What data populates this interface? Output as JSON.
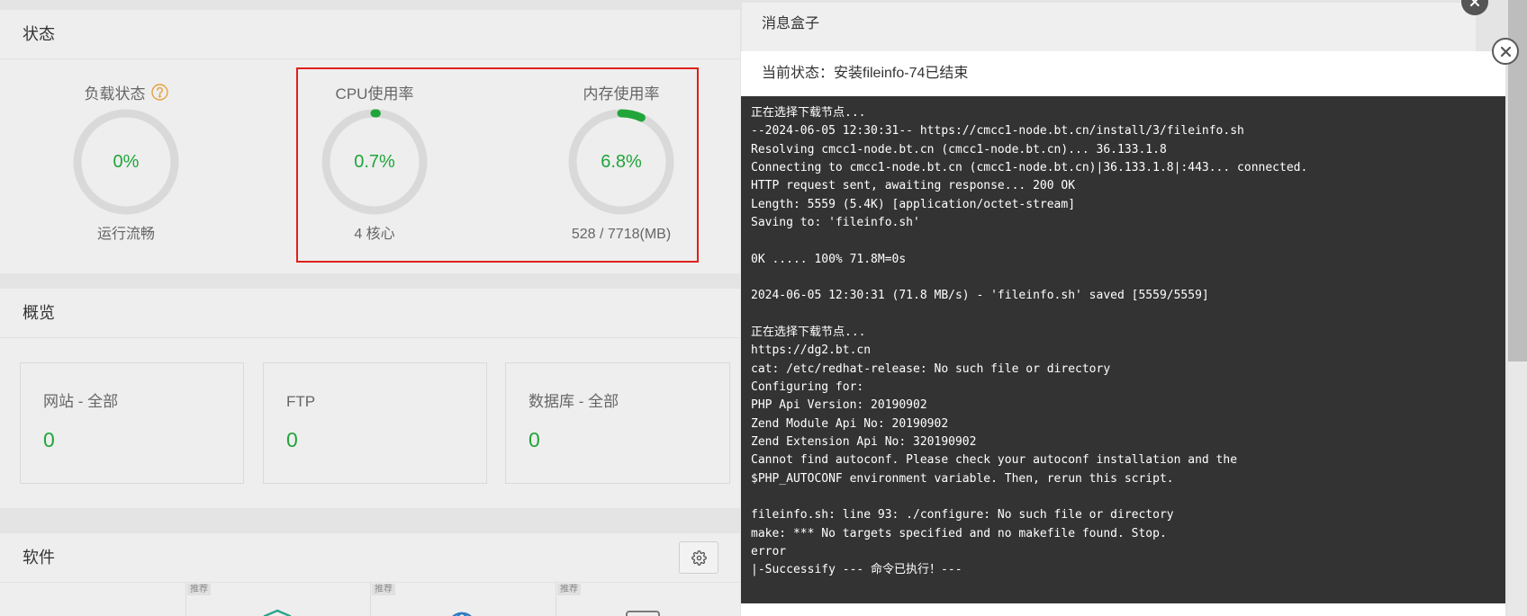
{
  "status_panel": {
    "title": "状态",
    "gauges": [
      {
        "title": "负载状态",
        "help_icon": "help-icon",
        "value": 0,
        "label": "0%",
        "caption": "运行流畅"
      },
      {
        "title": "CPU使用率",
        "value": 0.7,
        "label": "0.7%",
        "caption": "4 核心"
      },
      {
        "title": "内存使用率",
        "value": 6.8,
        "label": "6.8%",
        "caption": "528 / 7718(MB)"
      }
    ]
  },
  "overview_panel": {
    "title": "概览",
    "cards": [
      {
        "title": "网站 - 全部",
        "value": "0"
      },
      {
        "title": "FTP",
        "value": "0"
      },
      {
        "title": "数据库 - 全部",
        "value": "0"
      }
    ]
  },
  "software_panel": {
    "title": "软件",
    "settings_icon": "gear-icon",
    "items": [
      {
        "tag": "推荐",
        "icon": "shield-icon"
      },
      {
        "tag": "推荐",
        "icon": "globe-icon"
      },
      {
        "tag": "推荐",
        "icon": "keyboard-icon"
      }
    ]
  },
  "message_box": {
    "title": "消息盒子",
    "close_icon": "close-icon"
  },
  "install_dialog": {
    "title": "当前状态：安装fileinfo-74已结束",
    "close_icon": "close-icon",
    "log_lines": [
      "正在选择下载节点...",
      "--2024-06-05 12:30:31-- https://cmcc1-node.bt.cn/install/3/fileinfo.sh",
      "Resolving cmcc1-node.bt.cn (cmcc1-node.bt.cn)... 36.133.1.8",
      "Connecting to cmcc1-node.bt.cn (cmcc1-node.bt.cn)|36.133.1.8|:443... connected.",
      "HTTP request sent, awaiting response... 200 OK",
      "Length: 5559 (5.4K) [application/octet-stream]",
      "Saving to: 'fileinfo.sh'",
      "",
      "0K ..... 100% 71.8M=0s",
      "",
      "2024-06-05 12:30:31 (71.8 MB/s) - 'fileinfo.sh' saved [5559/5559]",
      "",
      "正在选择下载节点...",
      "https://dg2.bt.cn",
      "cat: /etc/redhat-release: No such file or directory",
      "Configuring for:",
      "PHP Api Version: 20190902",
      "Zend Module Api No: 20190902",
      "Zend Extension Api No: 320190902",
      "Cannot find autoconf. Please check your autoconf installation and the",
      "$PHP_AUTOCONF environment variable. Then, rerun this script.",
      "",
      "fileinfo.sh: line 93: ./configure: No such file or directory",
      "make: *** No targets specified and no makefile found. Stop.",
      "error",
      "|-Successify --- 命令已执行！---"
    ]
  },
  "colors": {
    "accent": "#20a53a",
    "highlight_border": "#e0201c",
    "help_icon": "#e6a23c",
    "terminal_bg": "#333333",
    "terminal_text": "#ffffff"
  }
}
